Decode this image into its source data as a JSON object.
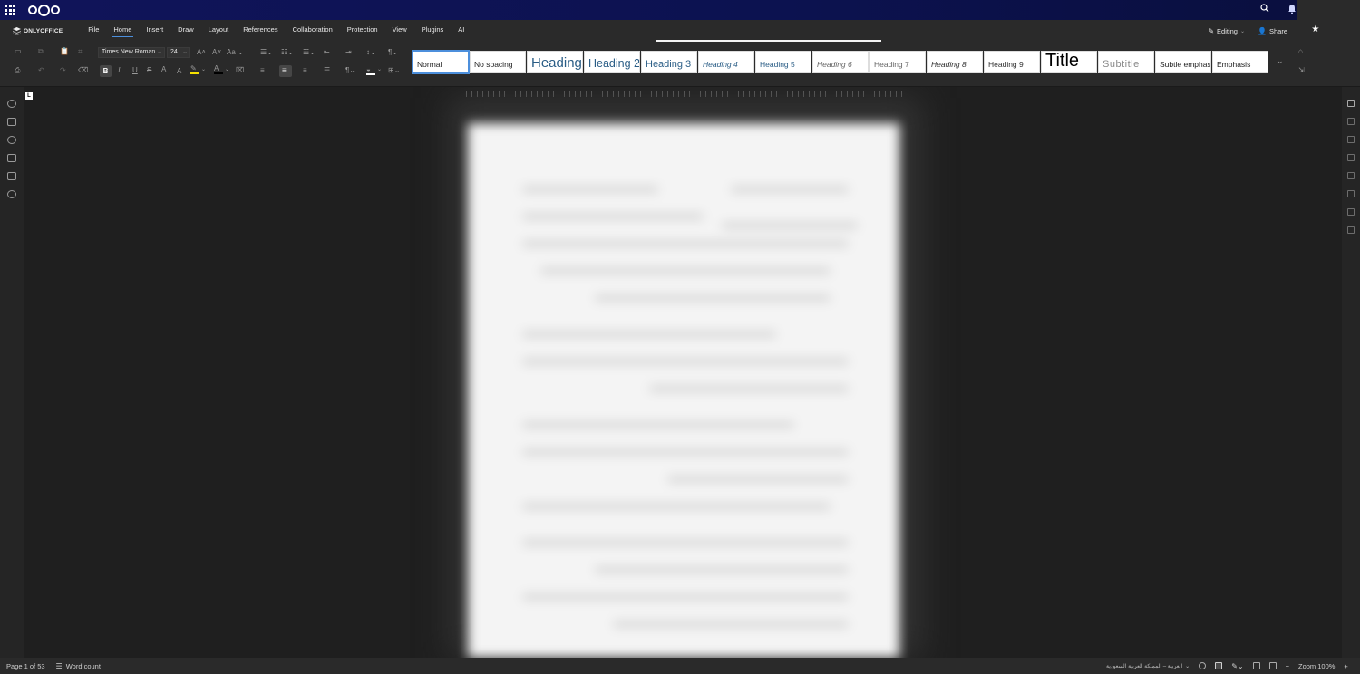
{
  "topbar": {
    "app_menu_icon": "apps-grid-icon",
    "logo_icon": "nextcloud-logo-icon",
    "search_icon": "search-icon",
    "notifications_icon": "bell-icon"
  },
  "menubar": {
    "product_name": "ONLYOFFICE",
    "tabs": [
      "File",
      "Home",
      "Insert",
      "Draw",
      "Layout",
      "References",
      "Collaboration",
      "Protection",
      "View",
      "Plugins",
      "AI"
    ],
    "active_tab": "Home",
    "editing_label": "Editing",
    "share_label": "Share"
  },
  "toolbar": {
    "font_family": "Times New Roman",
    "font_size": "24",
    "bold_label": "B",
    "italic_label": "I",
    "underline_label": "U",
    "strike_label": "S",
    "superscript_label": "A",
    "subscript_label": "A",
    "grow_label": "A",
    "shrink_label": "A",
    "case_label": "Aa",
    "highlight_color": "#f4e000",
    "font_color": "#000000",
    "pilcrow_label": "¶"
  },
  "styles": [
    {
      "label": "Normal",
      "cls": "normal"
    },
    {
      "label": "No spacing",
      "cls": "nospace"
    },
    {
      "label": "Heading 1",
      "cls": "h1"
    },
    {
      "label": "Heading 2",
      "cls": "h2"
    },
    {
      "label": "Heading 3",
      "cls": "h3"
    },
    {
      "label": "Heading 4",
      "cls": "h4"
    },
    {
      "label": "Heading 5",
      "cls": "h5"
    },
    {
      "label": "Heading 6",
      "cls": "h6"
    },
    {
      "label": "Heading 7",
      "cls": "h7"
    },
    {
      "label": "Heading 8",
      "cls": "h8"
    },
    {
      "label": "Heading 9",
      "cls": "h9"
    },
    {
      "label": "Title",
      "cls": "title"
    },
    {
      "label": "Subtitle",
      "cls": "subtitle"
    },
    {
      "label": "Subtle emphasis",
      "cls": "subtle"
    },
    {
      "label": "Emphasis",
      "cls": "emph"
    }
  ],
  "selected_style": "Normal",
  "left_rail_icons": [
    "search-icon",
    "comment-icon",
    "chat-icon",
    "navigation-icon",
    "feedback-icon",
    "info-icon"
  ],
  "right_rail_icons": [
    "paragraph-settings-icon",
    "table-settings-icon",
    "image-settings-icon",
    "header-footer-icon",
    "shape-settings-icon",
    "chart-settings-icon",
    "text-art-icon",
    "mail-merge-icon"
  ],
  "ruler": {
    "tab_marker": "L"
  },
  "statusbar": {
    "page_info": "Page 1 of 53",
    "word_count": "Word count",
    "language": "العربية – المملكة العربية السعودية",
    "zoom": "Zoom 100%",
    "zoom_out": "−",
    "zoom_in": "+"
  }
}
